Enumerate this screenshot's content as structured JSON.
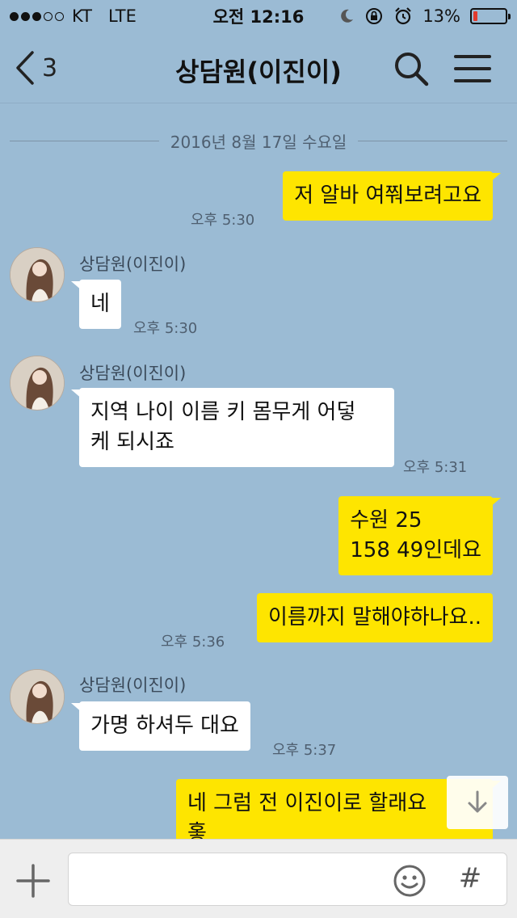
{
  "status_bar": {
    "carrier": "KT",
    "network": "LTE",
    "time": "오전 12:16",
    "battery": "13%",
    "battery_level": 0.13,
    "signal_bars": 3,
    "icons": [
      "moon-icon",
      "orientation-lock-icon",
      "alarm-icon"
    ]
  },
  "nav": {
    "back_count": "3",
    "title": "상담원(이진이)",
    "icons": [
      "back-chevron-icon",
      "search-icon",
      "menu-icon"
    ]
  },
  "chat": {
    "date": "2016년 8월 17일 수요일",
    "sender_name": "상담원(이진이)",
    "messages": [
      {
        "from": "me",
        "text": "저 알바 여쭤보려고요",
        "time": "오후 5:30"
      },
      {
        "from": "other",
        "text": "네",
        "time": "오후 5:30"
      },
      {
        "from": "other",
        "text": "지역 나이 이름 키  몸무게 어덯\n케 되시죠",
        "time": "오후 5:31"
      },
      {
        "from": "me",
        "text": "수원 25\n158 49인데요",
        "time": ""
      },
      {
        "from": "me",
        "text": "이름까지 말해야하나요..",
        "time": "오후 5:36"
      },
      {
        "from": "other",
        "text": "가명 하셔두 대요",
        "time": "오후 5:37"
      },
      {
        "from": "me",
        "text": "네 그럼 전 이진이로 할래요\n홓",
        "time": ""
      }
    ]
  },
  "input": {
    "value": "",
    "placeholder": "",
    "icons": [
      "plus-icon",
      "emoji-icon",
      "hash-icon"
    ],
    "hash_label": "#"
  },
  "colors": {
    "background": "#9bbbd4",
    "my_bubble": "#fee500",
    "other_bubble": "#ffffff"
  }
}
